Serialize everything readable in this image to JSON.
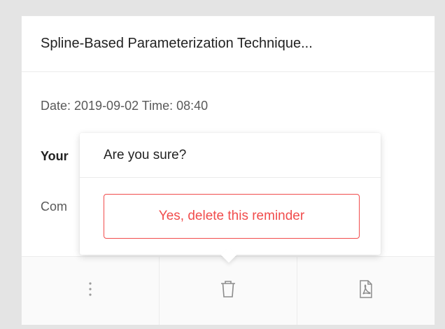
{
  "card": {
    "title": "Spline-Based Parameterization Technique...",
    "datetime": "Date: 2019-09-02 Time: 08:40",
    "your_label": "Your",
    "comment_label": "Com"
  },
  "popconfirm": {
    "question": "Are you sure?",
    "confirm_label": "Yes, delete this reminder"
  },
  "footer": {
    "actions": [
      {
        "icon": "more-vertical-icon"
      },
      {
        "icon": "trash-icon"
      },
      {
        "icon": "pdf-file-icon"
      }
    ]
  },
  "colors": {
    "danger": "#f14c4c",
    "background": "#e4e4e4"
  }
}
